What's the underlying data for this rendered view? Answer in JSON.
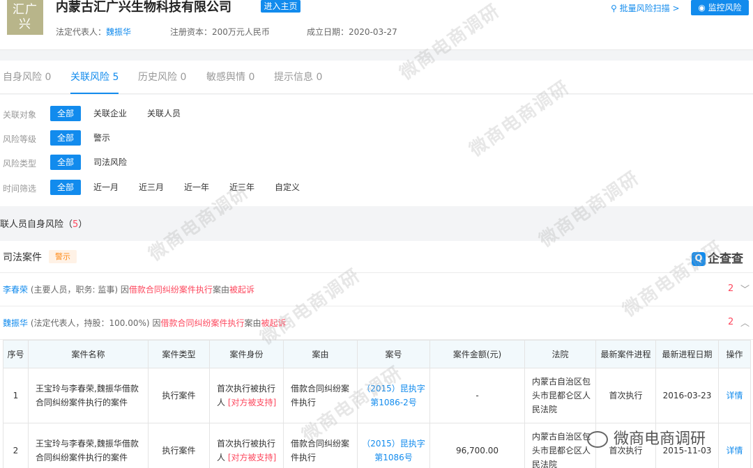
{
  "header": {
    "logo_text": "汇广兴",
    "company_name": "内蒙古汇广兴生物科技有限公司",
    "home_button": "进入主页",
    "legal_rep_label": "法定代表人：",
    "legal_rep_name": "魏振华",
    "capital": "注册资本：200万元人民币",
    "established": "成立日期：2020-03-27",
    "batch_scan": "批量风险扫描 >",
    "monitor_button": "监控风险"
  },
  "tabs": [
    {
      "label": "自身风险 0"
    },
    {
      "label": "关联风险 5"
    },
    {
      "label": "历史风险 0"
    },
    {
      "label": "敏感舆情 0"
    },
    {
      "label": "提示信息 0"
    }
  ],
  "filters": {
    "target_label": "关联对象",
    "target_options": [
      "全部",
      "关联企业",
      "关联人员"
    ],
    "level_label": "风险等级",
    "level_options": [
      "全部",
      "警示"
    ],
    "type_label": "风险类型",
    "type_options": [
      "全部",
      "司法风险"
    ],
    "time_label": "时间筛选",
    "time_options": [
      "全部",
      "近一月",
      "近三月",
      "近一年",
      "近三年",
      "自定义"
    ]
  },
  "section": {
    "title": "联人员自身风险（",
    "count": "5",
    "close": "）"
  },
  "judicial": {
    "title": "司法案件",
    "tag": "警示",
    "brand": "企查查"
  },
  "persons": [
    {
      "name": "李春荣",
      "role": "(主要人员，职务: 监事)",
      "because": "因",
      "reason": "借款合同纠纷案件执行",
      "mid": "案由",
      "result": "被起诉",
      "count": "2",
      "chevron": "﹀"
    },
    {
      "name": "魏振华",
      "role": "(法定代表人，持股：100.00%)",
      "because": "因",
      "reason": "借款合同纠纷案件执行",
      "mid": "案由",
      "result": "被起诉",
      "count": "2",
      "chevron": "︿"
    }
  ],
  "table": {
    "headers": [
      "序号",
      "案件名称",
      "案件类型",
      "案件身份",
      "案由",
      "案号",
      "案件金额(元)",
      "法院",
      "最新案件进程",
      "最新进程日期",
      "操作"
    ],
    "rows": [
      {
        "no": "1",
        "name": "王宝玲与李春荣,魏振华借款合同纠纷案件执行的案件",
        "type": "执行案件",
        "identity": "首次执行被执行人",
        "identity_tag": "[对方被支持]",
        "cause": "借款合同纠纷案件执行",
        "case_no": "（2015）昆执字第1086-2号",
        "amount": "-",
        "court": "内蒙古自治区包头市昆都仑区人民法院",
        "progress": "首次执行",
        "date": "2016-03-23",
        "action": "详情"
      },
      {
        "no": "2",
        "name": "王宝玲与李春荣,魏振华借款合同纠纷案件执行的案件",
        "type": "执行案件",
        "identity": "首次执行被执行人",
        "identity_tag": "[对方被支持]",
        "cause": "借款合同纠纷案件执行",
        "case_no": "（2015）昆执字第1086号",
        "amount": "96,700.00",
        "court": "内蒙古自治区包头市昆都仑区人民法院",
        "progress": "首次执行",
        "date": "2015-11-03",
        "action": "详情"
      }
    ]
  },
  "watermark": {
    "text": "微商电商调研"
  },
  "colors": {
    "accent": "#128bed",
    "danger": "#fd485e",
    "warning": "#ff8c1a"
  }
}
